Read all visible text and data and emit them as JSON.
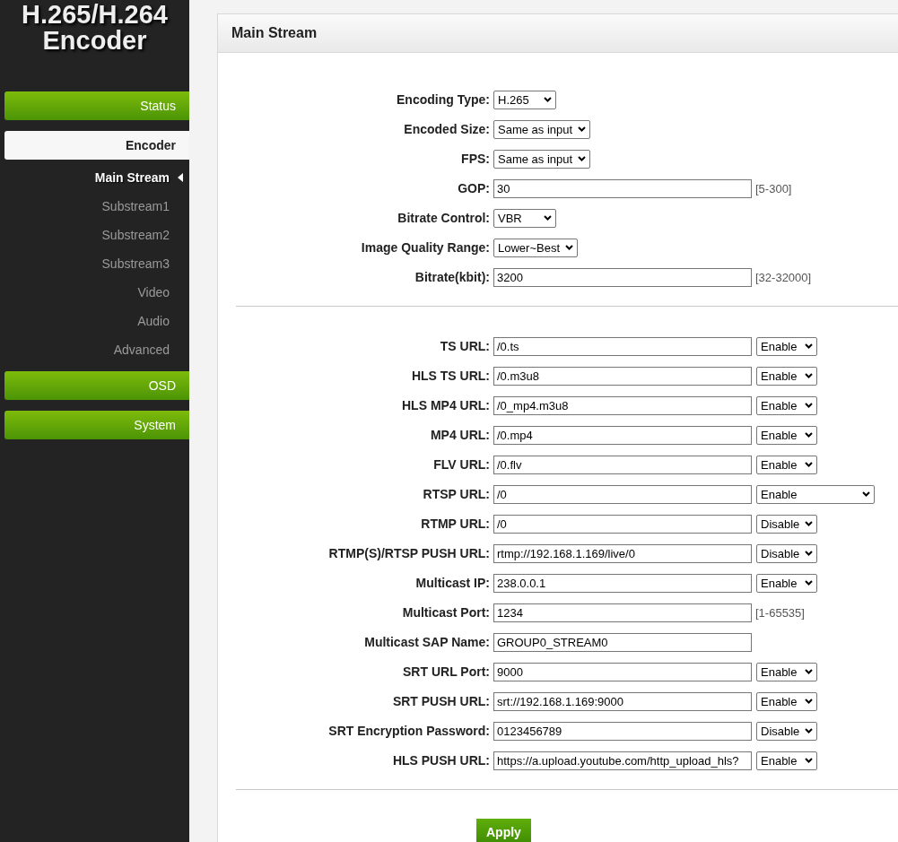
{
  "logo": {
    "line1": "H.265/H.264",
    "line2": "Encoder"
  },
  "sidebar": {
    "items": [
      {
        "label": "Status",
        "selected": false
      },
      {
        "label": "Encoder",
        "selected": true,
        "children": [
          {
            "label": "Main Stream",
            "selected": true
          },
          {
            "label": "Substream1",
            "selected": false
          },
          {
            "label": "Substream2",
            "selected": false
          },
          {
            "label": "Substream3",
            "selected": false
          },
          {
            "label": "Video",
            "selected": false
          },
          {
            "label": "Audio",
            "selected": false
          },
          {
            "label": "Advanced",
            "selected": false
          }
        ]
      },
      {
        "label": "OSD",
        "selected": false
      },
      {
        "label": "System",
        "selected": false
      }
    ]
  },
  "panel": {
    "title": "Main Stream",
    "sections": [
      {
        "rows": [
          {
            "kind": "select",
            "label": "Encoding Type:",
            "select": "H.265"
          },
          {
            "kind": "select",
            "label": "Encoded Size:",
            "select": "Same as input"
          },
          {
            "kind": "select",
            "label": "FPS:",
            "select": "Same as input"
          },
          {
            "kind": "input",
            "label": "GOP:",
            "value": "30",
            "hint": "[5-300]"
          },
          {
            "kind": "select",
            "label": "Bitrate Control:",
            "select": "VBR"
          },
          {
            "kind": "select",
            "label": "Image Quality Range:",
            "select": "Lower~Best"
          },
          {
            "kind": "input",
            "label": "Bitrate(kbit):",
            "value": "3200",
            "hint": "[32-32000]"
          }
        ]
      },
      {
        "rows": [
          {
            "kind": "input",
            "label": "TS URL:",
            "value": "/0.ts",
            "select": "Enable"
          },
          {
            "kind": "input",
            "label": "HLS TS URL:",
            "value": "/0.m3u8",
            "select": "Enable"
          },
          {
            "kind": "input",
            "label": "HLS MP4 URL:",
            "value": "/0_mp4.m3u8",
            "select": "Enable"
          },
          {
            "kind": "input",
            "label": "MP4 URL:",
            "value": "/0.mp4",
            "select": "Enable"
          },
          {
            "kind": "input",
            "label": "FLV URL:",
            "value": "/0.flv",
            "select": "Enable"
          },
          {
            "kind": "input",
            "label": "RTSP URL:",
            "value": "/0",
            "select": "Enable",
            "wide": true
          },
          {
            "kind": "input",
            "label": "RTMP URL:",
            "value": "/0",
            "select": "Disable"
          },
          {
            "kind": "input",
            "label": "RTMP(S)/RTSP PUSH URL:",
            "value": "rtmp://192.168.1.169/live/0",
            "select": "Disable"
          },
          {
            "kind": "input",
            "label": "Multicast IP:",
            "value": "238.0.0.1",
            "select": "Enable"
          },
          {
            "kind": "input",
            "label": "Multicast Port:",
            "value": "1234",
            "hint": "[1-65535]"
          },
          {
            "kind": "input",
            "label": "Multicast SAP Name:",
            "value": "GROUP0_STREAM0"
          },
          {
            "kind": "input",
            "label": "SRT URL Port:",
            "value": "9000",
            "select": "Enable"
          },
          {
            "kind": "input",
            "label": "SRT PUSH URL:",
            "value": "srt://192.168.1.169:9000",
            "select": "Enable"
          },
          {
            "kind": "input",
            "label": "SRT Encryption Password:",
            "value": "0123456789",
            "select": "Disable"
          },
          {
            "kind": "input",
            "label": "HLS PUSH URL:",
            "value": "https://a.upload.youtube.com/http_upload_hls?",
            "select": "Enable"
          }
        ]
      }
    ],
    "apply_button": "Apply"
  }
}
